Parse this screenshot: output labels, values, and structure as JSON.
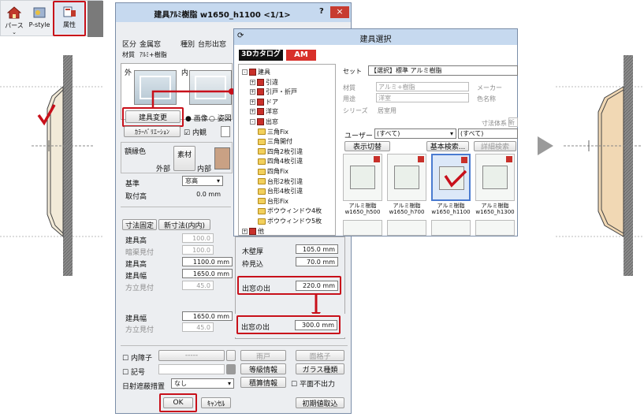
{
  "toolbar": {
    "items": [
      {
        "label": "パース"
      },
      {
        "label": "P-style"
      },
      {
        "label": "属性"
      }
    ]
  },
  "dlg": {
    "title": "建具ｱﾙﾐ樹脂 w1650_h1100 <1/1>",
    "help": "?",
    "close": "×",
    "kubun_label": "区分",
    "kubun_value": "金属窓",
    "shubetsu_label": "種別",
    "shubetsu_value": "台形出窓",
    "zaishitsu_label": "材質",
    "zaishitsu_value": "ｱﾙﾐ+樹脂",
    "outside": "外",
    "inside": "内",
    "change_btn": "建具変更",
    "radio_image": "画像",
    "radio_figure": "姿図",
    "color_btn": "ｶﾗｰﾊﾞﾘｴｰｼｮﾝ",
    "inner_view": "内観",
    "frame_color": "額縁色",
    "material": "素材",
    "outer": "外部",
    "inner": "内部",
    "base_label": "基準",
    "base_value": "窓高",
    "mount_label": "取付高",
    "mount_value": "0.0 mm",
    "dim_fixed": "寸法固定",
    "new_dim": "新寸法(内内)",
    "rows": [
      {
        "label": "建具高",
        "value": "100.0",
        "dis": true
      },
      {
        "label": "暗渠見付",
        "value": "100.0",
        "dis": true
      },
      {
        "label": "建具高",
        "value": "1100.0 mm",
        "dis": false
      },
      {
        "label": "建具幅",
        "value": "1650.0 mm",
        "dis": false
      },
      {
        "label": "方立見付",
        "value": "45.0",
        "dis": true
      }
    ],
    "rows2": [
      {
        "label": "建具幅",
        "value": "1650.0 mm",
        "dis": false
      },
      {
        "label": "方立見付",
        "value": "45.0",
        "dis": true
      }
    ],
    "inner_shoji": "内障子",
    "symbol": "記号",
    "shade_label": "日射遮蔽措置",
    "shade_value": "なし",
    "amado": "雨戸",
    "koshi": "面格子",
    "grade": "等級情報",
    "glass": "ガラス種類",
    "estimate": "積算情報",
    "plane_no": "平面不出力",
    "ok": "OK",
    "cancel": "ｷｬﾝｾﾙ",
    "init": "初期値取込",
    "wall_thk_label": "木壁厚",
    "wall_thk_value": "105.0 mm",
    "frame_label": "枠見込",
    "frame_value": "70.0 mm",
    "bay_label": "出窓の出",
    "bay_value": "220.0 mm",
    "bay_label2": "出窓の出",
    "bay_value2": "300.0 mm",
    "dash": "-----"
  },
  "cat": {
    "title": "建具選択",
    "tab1": "3Dカタログ",
    "tab2": "AM",
    "tree": [
      {
        "label": "建具",
        "lvl": 0,
        "pm": "-",
        "kind": "book"
      },
      {
        "label": "引違",
        "lvl": 1,
        "pm": "+",
        "kind": "book"
      },
      {
        "label": "引戸・折戸",
        "lvl": 1,
        "pm": "+",
        "kind": "book"
      },
      {
        "label": "ドア",
        "lvl": 1,
        "pm": "+",
        "kind": "book"
      },
      {
        "label": "洋窓",
        "lvl": 1,
        "pm": "+",
        "kind": "book"
      },
      {
        "label": "出窓",
        "lvl": 1,
        "pm": "-",
        "kind": "book"
      },
      {
        "label": "三角Fix",
        "lvl": 2,
        "kind": "fold"
      },
      {
        "label": "三角開付",
        "lvl": 2,
        "kind": "fold"
      },
      {
        "label": "四角2枚引違",
        "lvl": 2,
        "kind": "fold"
      },
      {
        "label": "四角4枚引違",
        "lvl": 2,
        "kind": "fold"
      },
      {
        "label": "四角Fix",
        "lvl": 2,
        "kind": "fold"
      },
      {
        "label": "台形2枚引違",
        "lvl": 2,
        "kind": "fold"
      },
      {
        "label": "台形4枚引違",
        "lvl": 2,
        "kind": "fold"
      },
      {
        "label": "台形Fix",
        "lvl": 2,
        "kind": "fold"
      },
      {
        "label": "ボウウィンドウ4枚",
        "lvl": 2,
        "kind": "fold"
      },
      {
        "label": "ボウウィンドウ5枚",
        "lvl": 2,
        "kind": "fold"
      },
      {
        "label": "他",
        "lvl": 0,
        "pm": "+",
        "kind": "book"
      }
    ],
    "set_label": "セット",
    "set_value": "【選択】標準 アルミ樹脂",
    "props": [
      {
        "label": "材質",
        "value": "アルミ+樹脂"
      },
      {
        "label": "用途",
        "value": "洋室"
      },
      {
        "label": "シリーズ",
        "value": "居室用"
      }
    ],
    "maker": "メーカー",
    "color_name": "色名称",
    "dim_system": "寸法体系",
    "new": "新",
    "user_label": "ユーザー",
    "user_value": "(すべて)",
    "all2": "(すべて)",
    "view_switch": "表示切替",
    "basic_search": "基本検索...",
    "detail_search": "詳細検索",
    "thumbs": [
      {
        "l1": "アルミ樹脂",
        "l2": "w1650_h500"
      },
      {
        "l1": "アルミ樹脂",
        "l2": "w1650_h700"
      },
      {
        "l1": "アルミ樹脂",
        "l2": "w1650_h1100"
      },
      {
        "l1": "アルミ樹脂",
        "l2": "w1650_h1300"
      }
    ]
  },
  "colors": {
    "accent": "#c8101a",
    "titlebar": "#c6d9ef",
    "swatch": "#c9a184"
  }
}
